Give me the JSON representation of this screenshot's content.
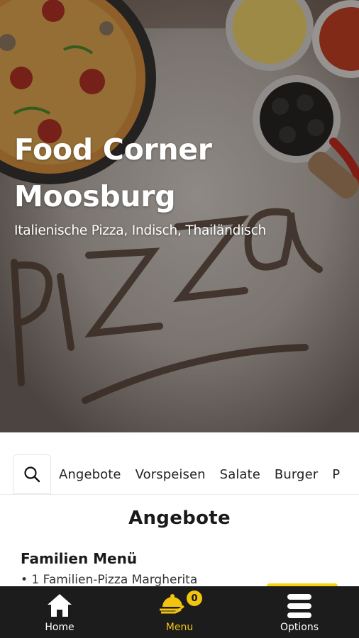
{
  "restaurant": {
    "name": "Food Corner Moosburg",
    "cuisines": "Italienische Pizza, Indisch, Thailändisch"
  },
  "categories": [
    "Angebote",
    "Vorspeisen",
    "Salate",
    "Burger",
    "P"
  ],
  "section": {
    "title": "Angebote",
    "items": [
      {
        "name": "Familien Menü",
        "description": "• 1 Familien-Pizza Margherita"
      }
    ]
  },
  "bottom_nav": {
    "home_label": "Home",
    "menu_label": "Menu",
    "options_label": "Options",
    "cart_count": "0"
  },
  "colors": {
    "accent": "#f2c40f",
    "nav_bg": "#1c1c1c",
    "nav_text": "#ffffff"
  },
  "icons": [
    "pizza-hero-image",
    "search-icon",
    "home-icon",
    "menu-cloche-icon",
    "options-bars-icon"
  ]
}
